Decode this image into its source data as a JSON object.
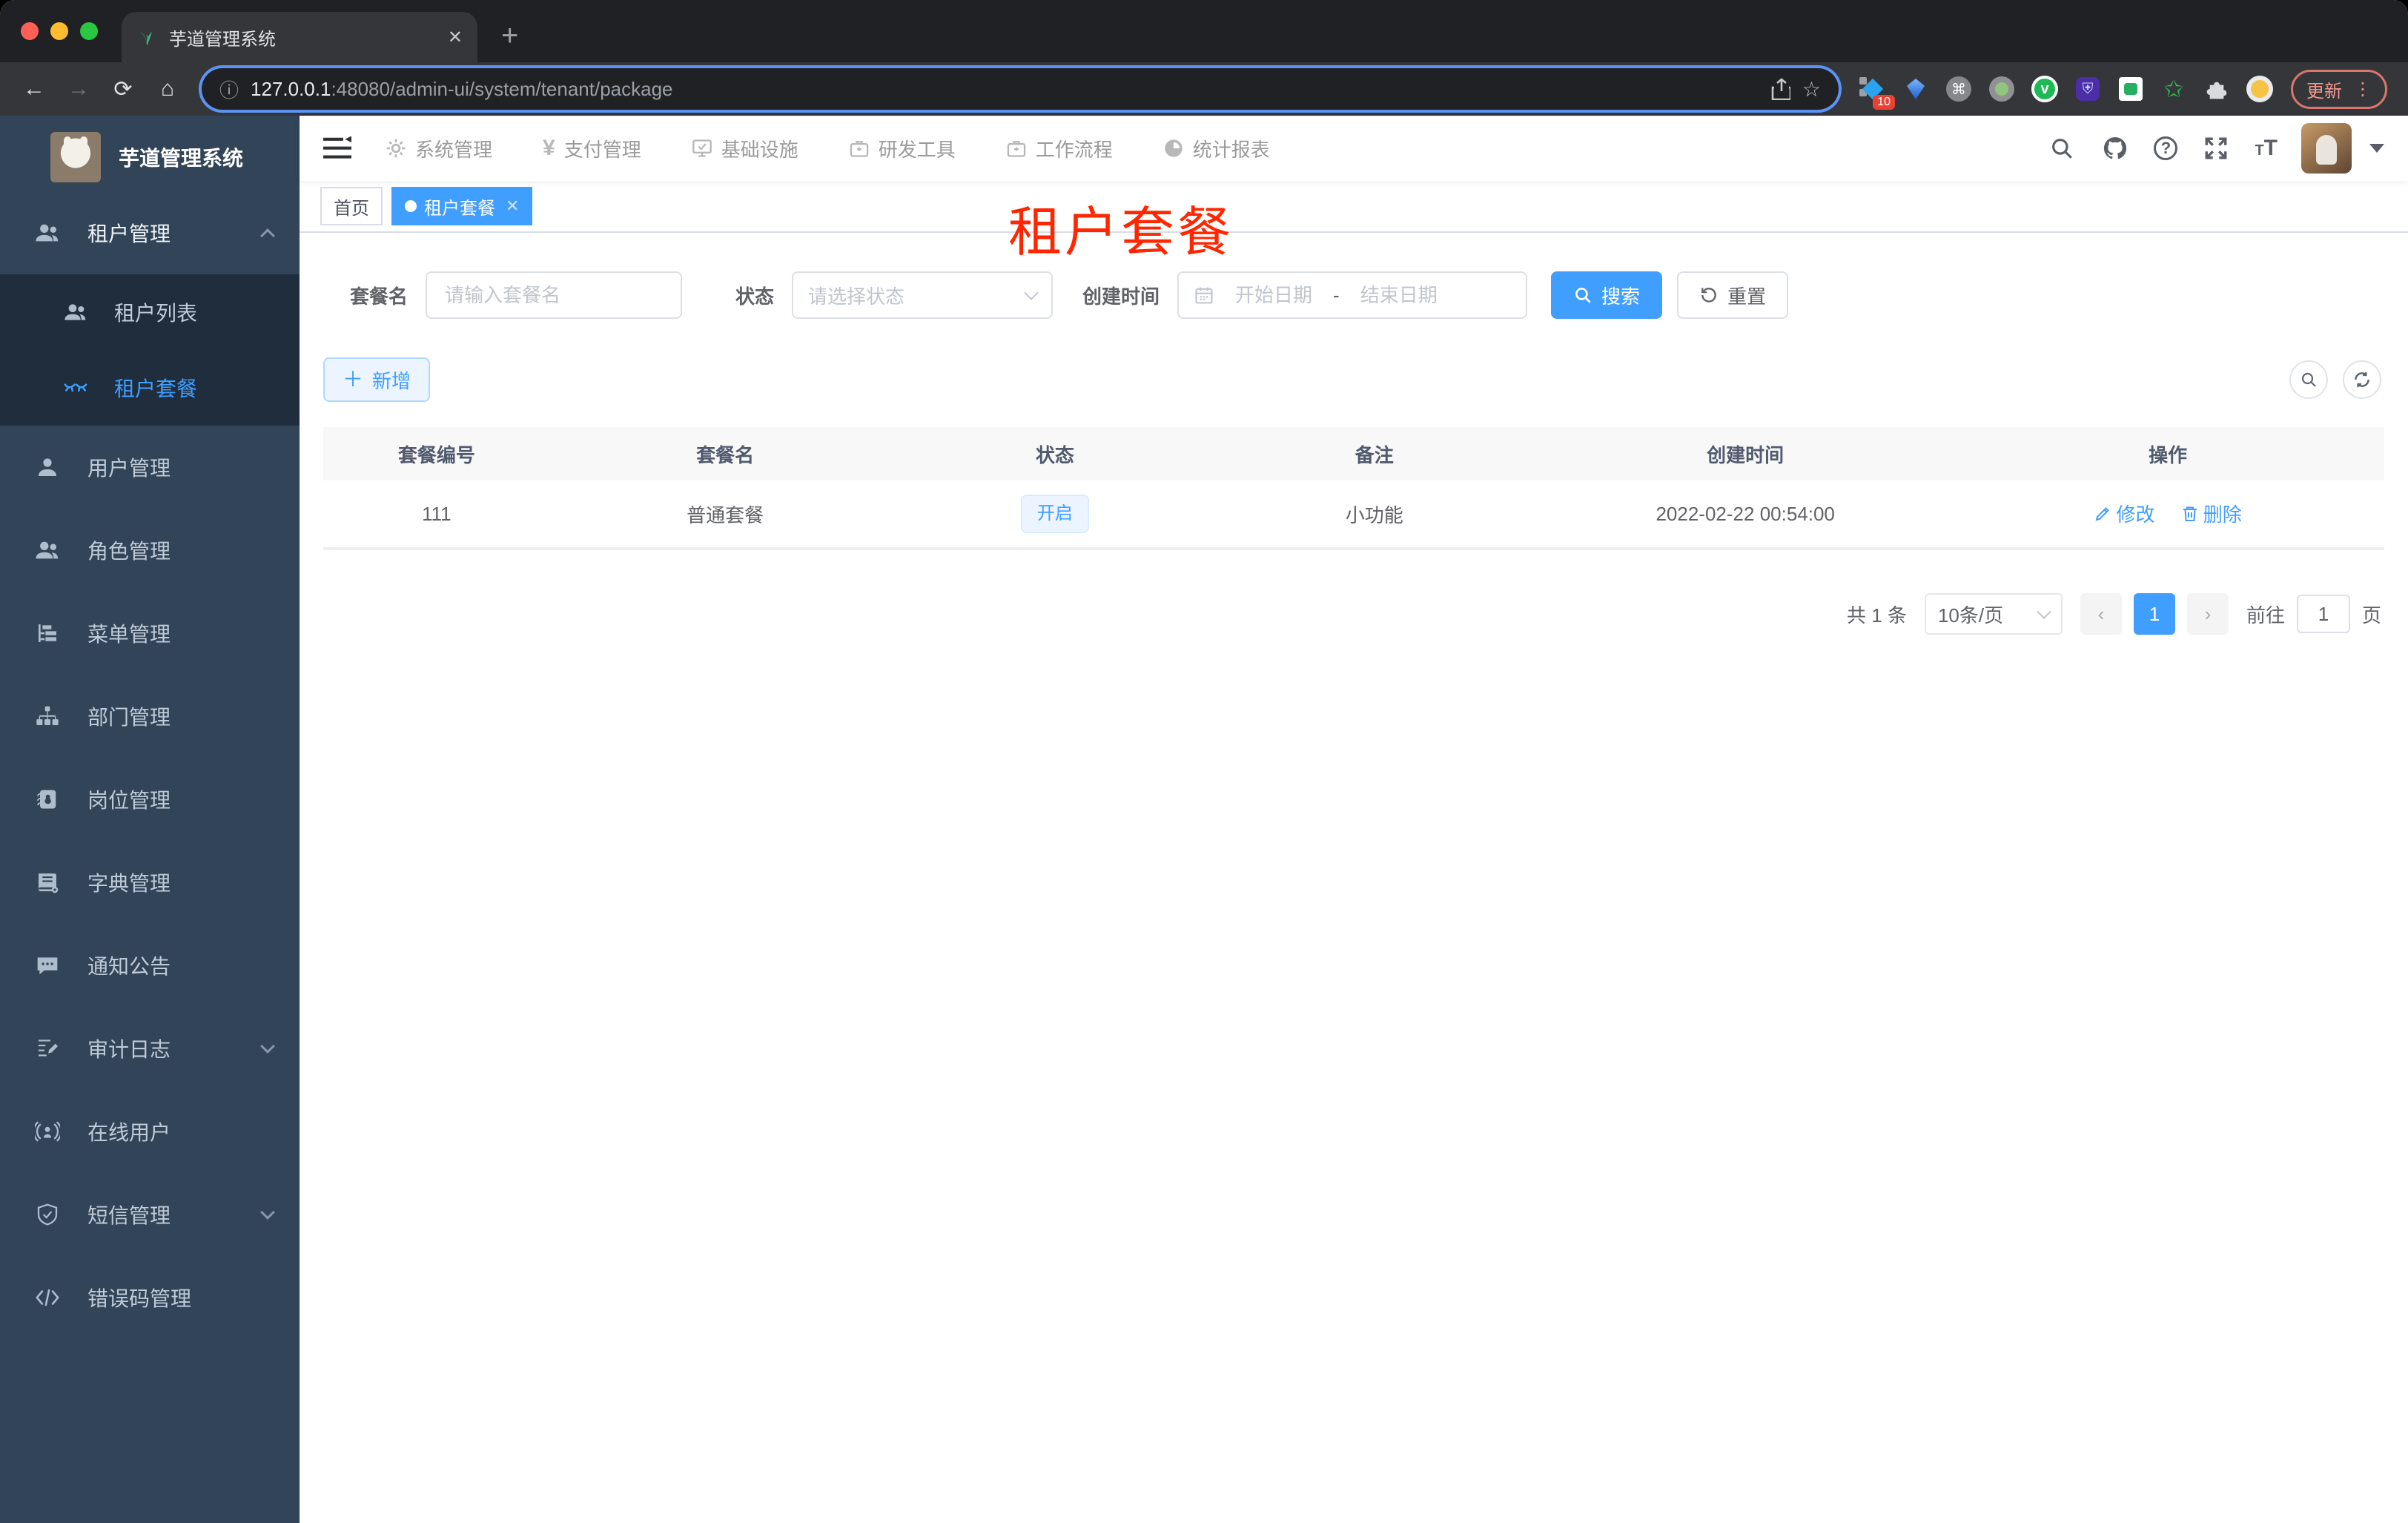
{
  "browser": {
    "tab_title": "芋道管理系统",
    "url_host": "127.0.0.1",
    "url_path": ":48080/admin-ui/system/tenant/package",
    "extension_badge": "10",
    "update_label": "更新"
  },
  "app_header": {
    "menus": [
      {
        "label": "系统管理"
      },
      {
        "label": "支付管理"
      },
      {
        "label": "基础设施"
      },
      {
        "label": "研发工具"
      },
      {
        "label": "工作流程"
      },
      {
        "label": "统计报表"
      }
    ]
  },
  "sidebar": {
    "title": "芋道管理系统",
    "items": [
      {
        "label": "租户管理",
        "children": [
          {
            "label": "租户列表"
          },
          {
            "label": "租户套餐"
          }
        ]
      },
      {
        "label": "用户管理"
      },
      {
        "label": "角色管理"
      },
      {
        "label": "菜单管理"
      },
      {
        "label": "部门管理"
      },
      {
        "label": "岗位管理"
      },
      {
        "label": "字典管理"
      },
      {
        "label": "通知公告"
      },
      {
        "label": "审计日志"
      },
      {
        "label": "在线用户"
      },
      {
        "label": "短信管理"
      },
      {
        "label": "错误码管理"
      }
    ]
  },
  "tags_view": {
    "tags": [
      {
        "label": "首页"
      },
      {
        "label": "租户套餐"
      }
    ]
  },
  "annotation": {
    "text": "租户套餐",
    "color": "#ff2600"
  },
  "filters": {
    "name_label": "套餐名",
    "name_placeholder": "请输入套餐名",
    "status_label": "状态",
    "status_placeholder": "请选择状态",
    "time_label": "创建时间",
    "start_placeholder": "开始日期",
    "range_separator": "-",
    "end_placeholder": "结束日期",
    "search_label": "搜索",
    "reset_label": "重置",
    "add_label": "新增"
  },
  "table": {
    "headers": [
      "套餐编号",
      "套餐名",
      "状态",
      "备注",
      "创建时间",
      "操作"
    ],
    "rows": [
      {
        "id": "111",
        "name": "普通套餐",
        "status": "开启",
        "remark": "小功能",
        "created_at": "2022-02-22 00:54:00",
        "edit_label": "修改",
        "delete_label": "删除"
      }
    ]
  },
  "pagination": {
    "total": "共 1 条",
    "page_size": "10条/页",
    "current_page": "1",
    "goto_label": "前往",
    "goto_value": "1",
    "unit_label": "页"
  },
  "colors": {
    "accent": "#409eff",
    "annotation_red": "#ff2600"
  }
}
